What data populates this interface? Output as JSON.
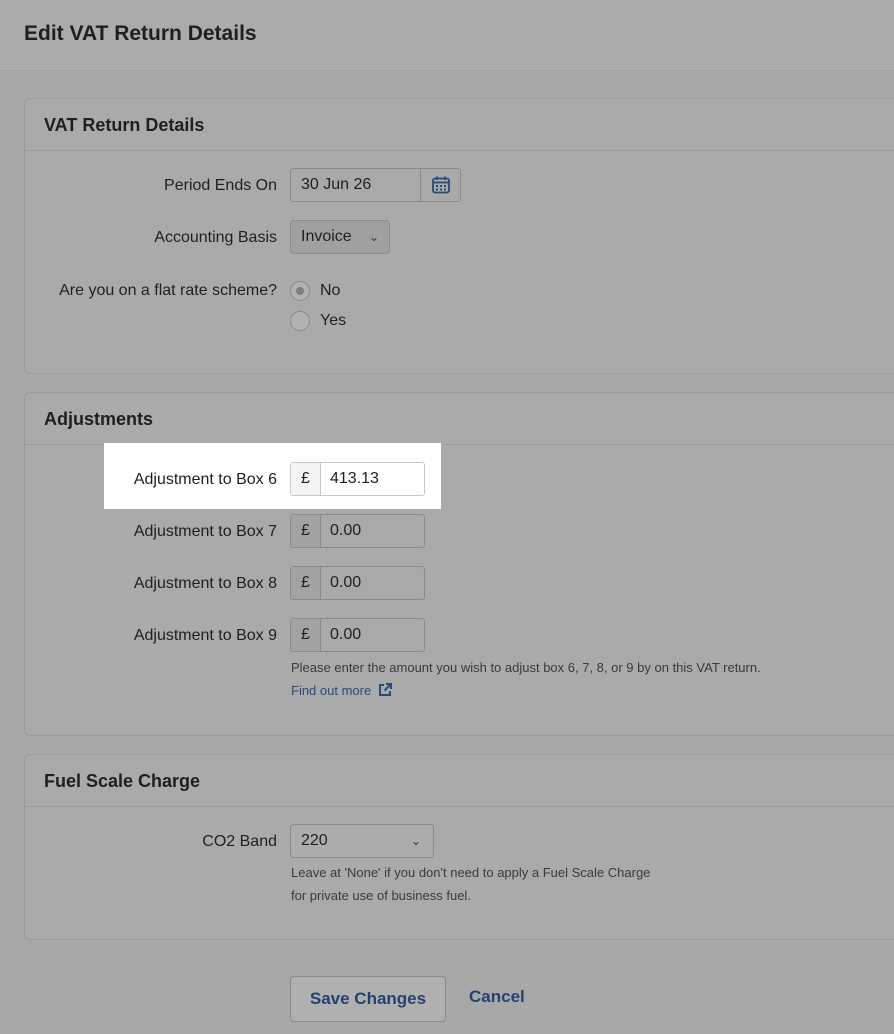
{
  "page": {
    "title": "Edit VAT Return Details"
  },
  "vat_details": {
    "title": "VAT Return Details",
    "period_label": "Period Ends On",
    "period_value": "30 Jun 26",
    "basis_label": "Accounting Basis",
    "basis_value": "Invoice",
    "flat_rate_label": "Are you on a flat rate scheme?",
    "flat_rate_options": [
      "No",
      "Yes"
    ],
    "flat_rate_selected": "No"
  },
  "adjustments": {
    "title": "Adjustments",
    "currency": "£",
    "rows": [
      {
        "label": "Adjustment to Box 6",
        "value": "413.13"
      },
      {
        "label": "Adjustment to Box 7",
        "value": "0.00"
      },
      {
        "label": "Adjustment to Box 8",
        "value": "0.00"
      },
      {
        "label": "Adjustment to Box 9",
        "value": "0.00"
      }
    ],
    "help": "Please enter the amount you wish to adjust box 6, 7, 8, or 9 by on this VAT return.",
    "link": "Find out more"
  },
  "fuel": {
    "title": "Fuel Scale Charge",
    "co2_label": "CO2 Band",
    "co2_value": "220",
    "help_line1": "Leave at 'None' if you don't need to apply a Fuel Scale Charge",
    "help_line2": "for private use of business fuel."
  },
  "actions": {
    "save": "Save Changes",
    "cancel": "Cancel"
  },
  "colors": {
    "link": "#2a4a77",
    "button_text": "#25426f"
  }
}
